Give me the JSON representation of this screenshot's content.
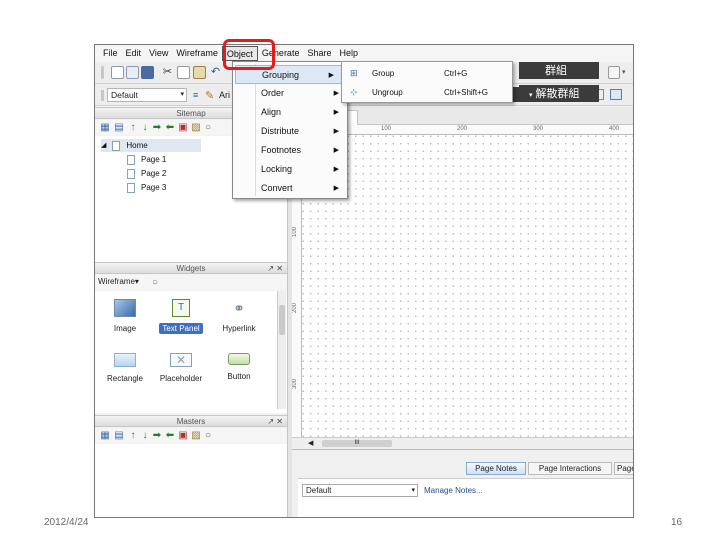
{
  "menubar": [
    "File",
    "Edit",
    "View",
    "Wireframe",
    "Object",
    "Generate",
    "Share",
    "Help"
  ],
  "toolbar2": {
    "style_select": "Default",
    "font_text": "Ari"
  },
  "grouping_tooltips": {
    "group": "群組",
    "ungroup": "解散群組"
  },
  "sitemap": {
    "title": "Sitemap",
    "controls": "↗ ✕",
    "root": "Home",
    "pages": [
      "Page 1",
      "Page 2",
      "Page 3"
    ]
  },
  "widgets": {
    "title": "Widgets",
    "controls": "↗ ✕",
    "library": "Wireframe",
    "items": [
      "Image",
      "Text Panel",
      "Hyperlink",
      "Rectangle",
      "Placeholder",
      "Button"
    ]
  },
  "masters": {
    "title": "Masters",
    "controls": "↗ ✕"
  },
  "canvas": {
    "tab_close": "✕",
    "ruler_h": [
      "100",
      "200",
      "300",
      "400"
    ],
    "ruler_v": [
      "100",
      "200",
      "300"
    ],
    "scroll_mark": "III"
  },
  "object_menu": {
    "items": [
      "Grouping",
      "Order",
      "Align",
      "Distribute",
      "Footnotes",
      "Locking",
      "Convert"
    ]
  },
  "grouping_submenu": [
    {
      "label": "Group",
      "shortcut": "Ctrl+G"
    },
    {
      "label": "Ungroup",
      "shortcut": "Ctrl+Shift+G"
    }
  ],
  "bottom_panel": {
    "tabs": [
      "Page Notes",
      "Page Interactions",
      "Page"
    ],
    "notes_select": "Default",
    "manage_link": "Manage Notes..."
  },
  "slide": {
    "date": "2012/4/24",
    "page_number": "16"
  },
  "colors": {
    "highlight_red": "#e21b1b",
    "selection_blue": "#3c6fc3",
    "menu_hover": "#dde8f6"
  }
}
